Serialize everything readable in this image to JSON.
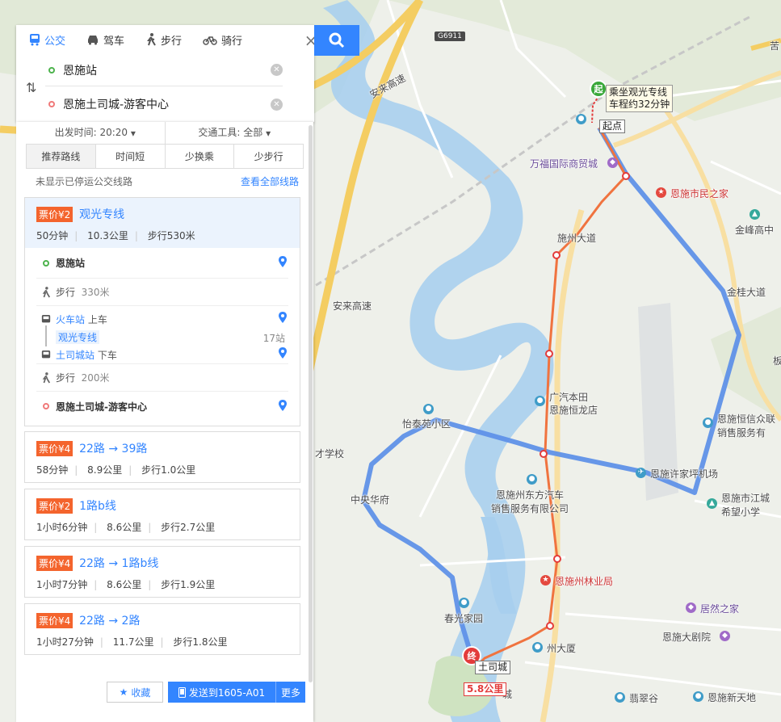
{
  "search": {
    "modes": [
      "公交",
      "驾车",
      "步行",
      "骑行"
    ],
    "from": "恩施站",
    "to": "恩施土司城-游客中心",
    "options": {
      "depart_label": "出发时间: 20:20",
      "vehicle_label": "交通工具: 全部"
    },
    "sort_tabs": [
      "推荐路线",
      "时间短",
      "少换乘",
      "少步行"
    ],
    "notice": "未显示已停运公交线路",
    "view_all": "查看全部线路"
  },
  "routes": [
    {
      "price": "票价¥2",
      "name": "观光专线",
      "time": "50分钟",
      "distance": "10.3公里",
      "walk": "步行530米"
    },
    {
      "price": "票价¥4",
      "name": "22路 → 39路",
      "time": "58分钟",
      "distance": "8.9公里",
      "walk": "步行1.0公里"
    },
    {
      "price": "票价¥2",
      "name": "1路b线",
      "time": "1小时6分钟",
      "distance": "8.6公里",
      "walk": "步行2.7公里"
    },
    {
      "price": "票价¥4",
      "name": "22路 → 1路b线",
      "time": "1小时7分钟",
      "distance": "8.6公里",
      "walk": "步行1.9公里"
    },
    {
      "price": "票价¥4",
      "name": "22路 → 2路",
      "time": "1小时27分钟",
      "distance": "11.7公里",
      "walk": "步行1.8公里"
    }
  ],
  "steps": {
    "start": "恩施站",
    "walk1": "步行",
    "walk1_dist": "330米",
    "board_stop": "火车站",
    "board_label": "上车",
    "line": "观光专线",
    "stops": "17站",
    "alight_stop": "土司城站",
    "alight_label": "下车",
    "walk2": "步行",
    "walk2_dist": "200米",
    "end": "恩施土司城-游客中心"
  },
  "bottom": {
    "favorite": "收藏",
    "send": "发送到1605-A01",
    "more": "更多"
  },
  "map": {
    "tip": [
      "乘坐观光专线",
      "车程约32分钟"
    ],
    "start_marker": "起",
    "start_tag": "起点",
    "end_marker": "终",
    "end_tag": "土司城",
    "distance": "5.8公里",
    "highway_badge": "G6911",
    "labels": {
      "wanfu": "万福国际商贸城",
      "minzhijia": "恩施市民之家",
      "jinfeng": "金峰高中",
      "shizhou": "施州大道",
      "jinguiroad": "金桂大道",
      "anlai1": "安来高速",
      "anlai2": "安来高速",
      "guangqi": "广汽本田",
      "hengLong": "恩施恒龙店",
      "yitai": "怡泰苑小区",
      "caixue": "才学校",
      "zhongyang": "中央华府",
      "dongfang1": "恩施州东方汽车",
      "dongfang2": "销售服务有限公司",
      "xujiaping": "恩施许家坪机场",
      "hengxin1": "恩施恒信众联",
      "hengxin2": "销售服务有",
      "jiangcheng1": "恩施市江城",
      "jiangcheng2": "希望小学",
      "linye": "恩施州林业局",
      "juranzhijia": "居然之家",
      "chunguang": "春光家园",
      "juyuan": "恩施大剧院",
      "zhouda": "州大厦",
      "feicui": "翡翠谷",
      "xintiandi": "恩施新天地",
      "cheng": "城",
      "ku": "苦",
      "ban": "板",
      "huozhan": "恩施"
    }
  }
}
